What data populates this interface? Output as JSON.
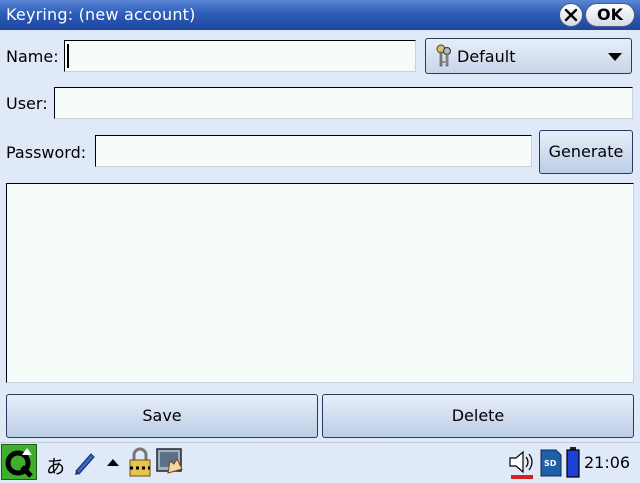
{
  "window": {
    "title": "Keyring: (new account)",
    "ok_label": "OK"
  },
  "form": {
    "name_label": "Name:",
    "name_value": "",
    "category": "Default",
    "user_label": "User:",
    "user_value": "",
    "password_label": "Password:",
    "password_value": "",
    "generate_label": "Generate",
    "notes_value": ""
  },
  "actions": {
    "save_label": "Save",
    "delete_label": "Delete"
  },
  "taskbar": {
    "input_method_glyph": "あ",
    "clock": "21:06",
    "icons": [
      "qtopia-logo-icon",
      "input-method-icon",
      "pen-icon",
      "up-arrow-icon",
      "lock-icon",
      "screenshot-icon",
      "speaker-icon",
      "sd-card-icon",
      "battery-icon"
    ]
  },
  "colors": {
    "titlebar": "#2f5db8",
    "background": "#dfe9f8",
    "field": "#f5fbf8"
  }
}
